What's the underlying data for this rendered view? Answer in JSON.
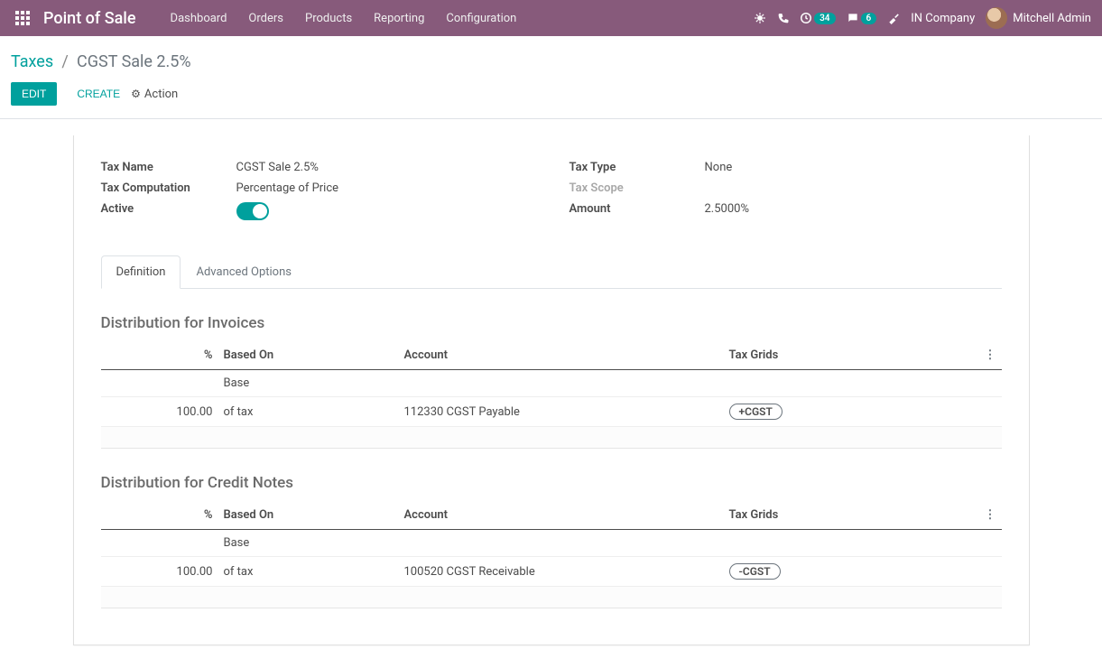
{
  "topbar": {
    "brand": "Point of Sale",
    "nav": [
      "Dashboard",
      "Orders",
      "Products",
      "Reporting",
      "Configuration"
    ],
    "activity_badge": "34",
    "message_badge": "6",
    "company": "IN Company",
    "user": "Mitchell Admin"
  },
  "breadcrumb": {
    "root": "Taxes",
    "sep": "/",
    "current": "CGST Sale 2.5%"
  },
  "controls": {
    "edit": "Edit",
    "create": "Create",
    "action": "Action"
  },
  "fields": {
    "tax_name_label": "Tax Name",
    "tax_name_value": "CGST Sale 2.5%",
    "tax_computation_label": "Tax Computation",
    "tax_computation_value": "Percentage of Price",
    "active_label": "Active",
    "tax_type_label": "Tax Type",
    "tax_type_value": "None",
    "tax_scope_label": "Tax Scope",
    "amount_label": "Amount",
    "amount_value": "2.5000%"
  },
  "tabs": {
    "definition": "Definition",
    "advanced": "Advanced Options"
  },
  "sections": {
    "invoices_title": "Distribution for Invoices",
    "credit_title": "Distribution for Credit Notes"
  },
  "table_headers": {
    "pct": "%",
    "based_on": "Based On",
    "account": "Account",
    "grids": "Tax Grids"
  },
  "invoices": [
    {
      "pct": "",
      "based_on": "Base",
      "account": "",
      "grid": ""
    },
    {
      "pct": "100.00",
      "based_on": "of tax",
      "account": "112330 CGST Payable",
      "grid": "+CGST"
    }
  ],
  "credits": [
    {
      "pct": "",
      "based_on": "Base",
      "account": "",
      "grid": ""
    },
    {
      "pct": "100.00",
      "based_on": "of tax",
      "account": "100520 CGST Receivable",
      "grid": "-CGST"
    }
  ]
}
